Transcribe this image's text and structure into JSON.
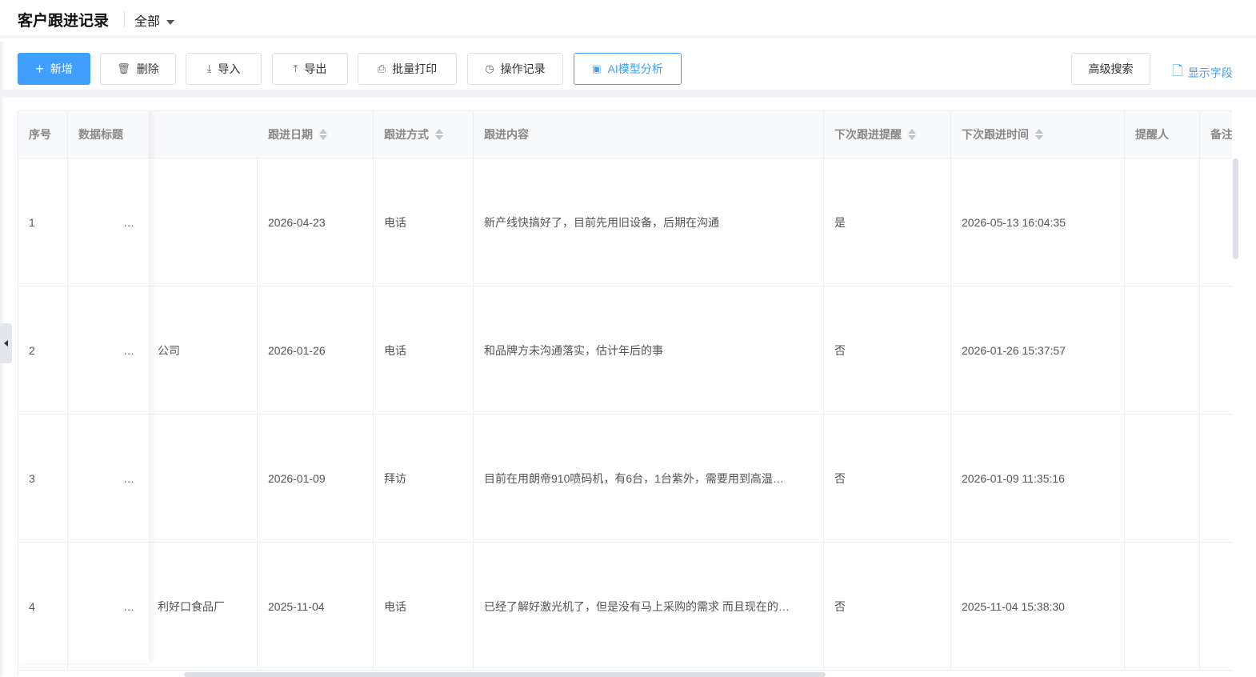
{
  "header": {
    "title": "客户跟进记录",
    "scope": "全部"
  },
  "toolbar": {
    "add": "新增",
    "delete": "删除",
    "import": "导入",
    "export": "导出",
    "print": "批量打印",
    "log": "操作记录",
    "ai": "AI模型分析",
    "advanced_search": "高级搜索",
    "show_fields": "显示字段"
  },
  "table": {
    "columns": [
      "序号",
      "数据标题",
      "跟进日期",
      "跟进方式",
      "跟进内容",
      "下次跟进提醒",
      "下次跟进时间",
      "提醒人",
      "备注"
    ],
    "rows": [
      {
        "index": "1",
        "title": "…",
        "customer": "",
        "date": "2026-04-23",
        "method": "电话",
        "content": "新产线快搞好了，目前先用旧设备，后期在沟通",
        "remind": "是",
        "next_time": "2026-05-13 16:04:35"
      },
      {
        "index": "2",
        "title": "…",
        "customer": "公司",
        "date": "2026-01-26",
        "method": "电话",
        "content": "和品牌方未沟通落实，估计年后的事",
        "remind": "否",
        "next_time": "2026-01-26 15:37:57"
      },
      {
        "index": "3",
        "title": "…",
        "customer": "",
        "date": "2026-01-09",
        "method": "拜访",
        "content": "目前在用朗帝910喷码机，有6台，1台紫外，需要用到高温…",
        "remind": "否",
        "next_time": "2026-01-09 11:35:16"
      },
      {
        "index": "4",
        "title": "…",
        "customer": "利好口食品厂",
        "date": "2025-11-04",
        "method": "电话",
        "content": "已经了解好激光机了，但是没有马上采购的需求 而且现在的…",
        "remind": "否",
        "next_time": "2025-11-04 15:38:30"
      }
    ]
  }
}
